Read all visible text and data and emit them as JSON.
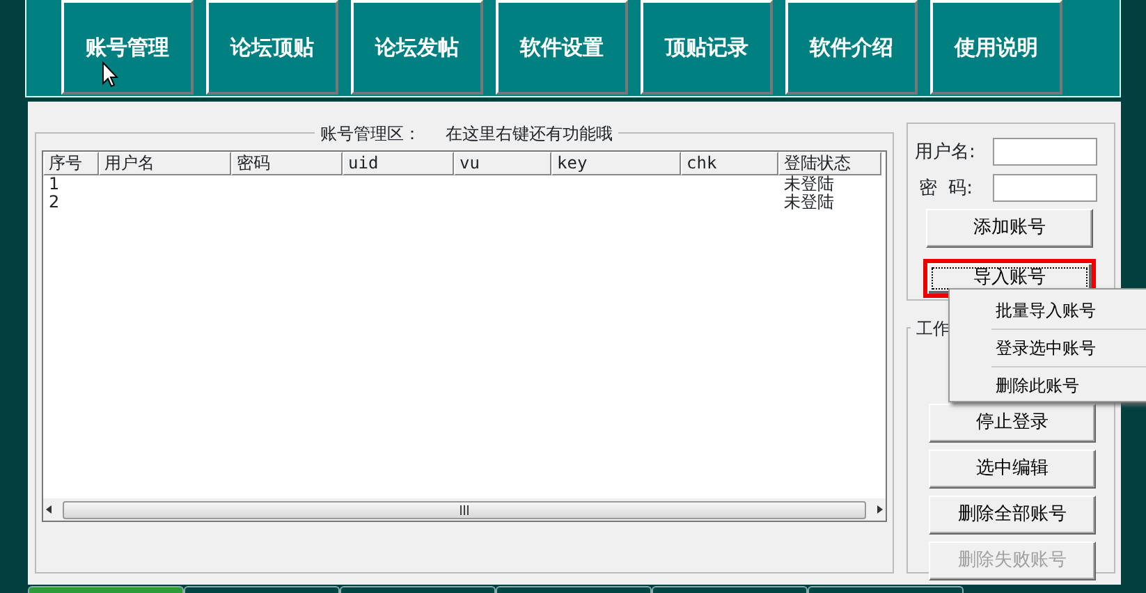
{
  "top_buttons": [
    {
      "label": "账号管理"
    },
    {
      "label": "论坛顶贴"
    },
    {
      "label": "论坛发帖"
    },
    {
      "label": "软件设置"
    },
    {
      "label": "顶贴记录"
    },
    {
      "label": "软件介绍"
    },
    {
      "label": "使用说明"
    }
  ],
  "account_group": {
    "title": "账号管理区：",
    "hint": "在这里右键还有功能哦"
  },
  "table": {
    "columns": [
      "序号",
      "用户名",
      "密码",
      "uid",
      "vu",
      "key",
      "chk",
      "登陆状态"
    ],
    "rows": [
      [
        "1",
        "",
        "",
        "",
        "",
        "",
        "",
        "未登陆"
      ],
      [
        "2",
        "",
        "",
        "",
        "",
        "",
        "",
        "未登陆"
      ]
    ]
  },
  "login_form": {
    "fields": [
      {
        "label": "用户名:"
      },
      {
        "label": "密 码:"
      }
    ],
    "buttons": [
      {
        "label": "添加账号",
        "highlighted": false
      },
      {
        "label": "导入账号",
        "highlighted": true
      }
    ]
  },
  "work_group": {
    "title": "工作",
    "buttons": [
      {
        "label": "停止登录",
        "disabled": false
      },
      {
        "label": "选中编辑",
        "disabled": false
      },
      {
        "label": "删除全部账号",
        "disabled": false
      },
      {
        "label": "删除失败账号",
        "disabled": true
      }
    ]
  },
  "context_menu": {
    "items": [
      "批量导入账号",
      "登录选中账号",
      "删除此账号"
    ]
  },
  "bottom_tabs": [
    {
      "selected": true
    },
    {
      "selected": false
    },
    {
      "selected": false
    },
    {
      "selected": false
    },
    {
      "selected": false
    },
    {
      "selected": false
    }
  ]
}
